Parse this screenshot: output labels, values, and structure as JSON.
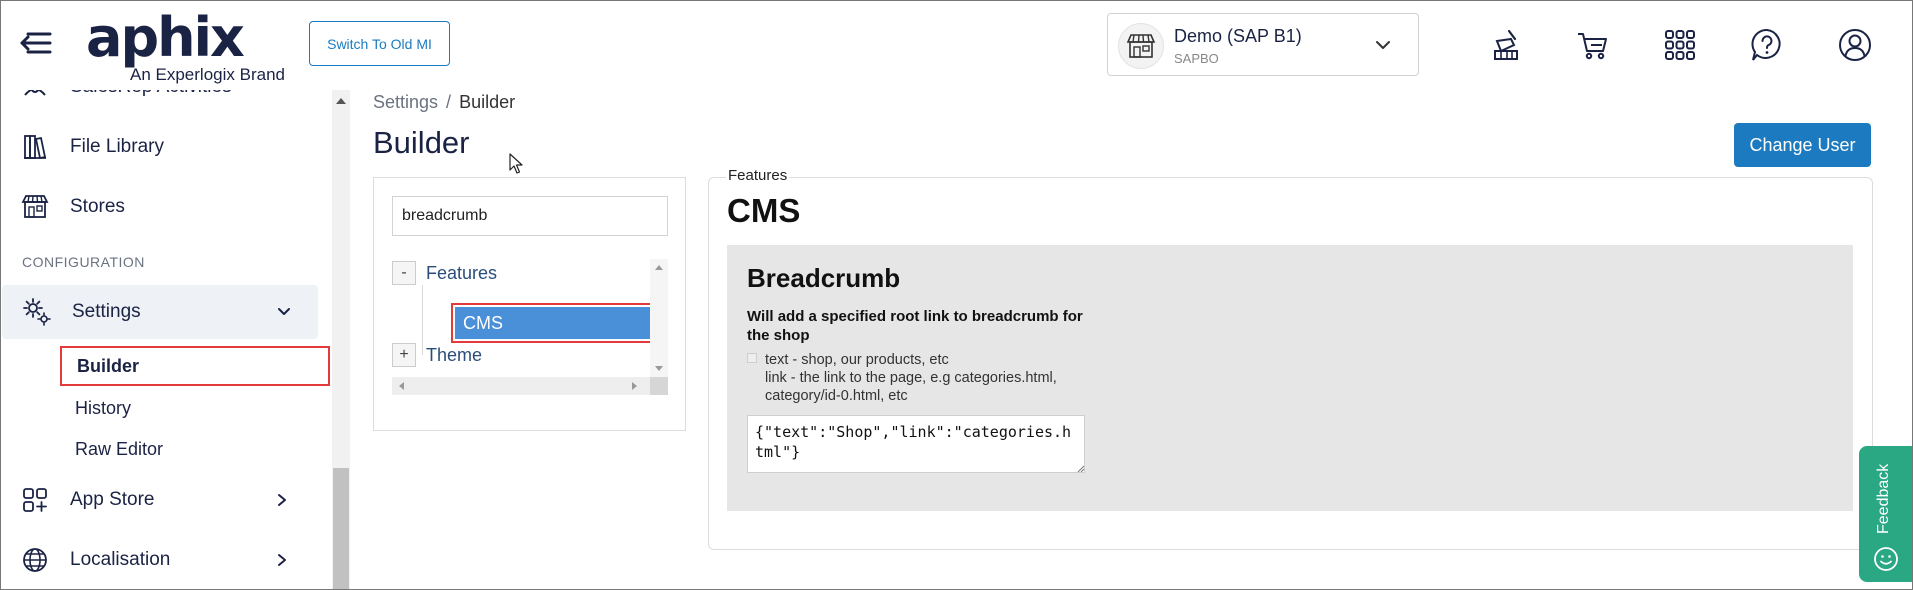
{
  "header": {
    "logo_main": "aphix",
    "logo_sub": "An Experlogix Brand",
    "old_mi_label": "Switch To Old MI",
    "company": {
      "name": "Demo (SAP B1)",
      "code": "SAPBO"
    }
  },
  "sidebar": {
    "items_top": [
      {
        "label": "SalesRep Activities"
      },
      {
        "label": "File Library"
      },
      {
        "label": "Stores"
      }
    ],
    "section_label": "CONFIGURATION",
    "settings_label": "Settings",
    "sub_items": [
      {
        "label": "Builder"
      },
      {
        "label": "History"
      },
      {
        "label": "Raw Editor"
      }
    ],
    "items_bottom": [
      {
        "label": "App Store"
      },
      {
        "label": "Localisation"
      }
    ]
  },
  "main": {
    "breadcrumb": {
      "parent": "Settings",
      "separator": "/",
      "current": "Builder"
    },
    "title": "Builder",
    "change_user_label": "Change User",
    "tree": {
      "search_value": "breadcrumb",
      "nodes": [
        {
          "label": "Features",
          "toggle": "-"
        },
        {
          "label": "CMS"
        },
        {
          "label": "Theme",
          "toggle": "+"
        }
      ]
    },
    "features": {
      "legend": "Features",
      "section_title": "CMS",
      "card": {
        "title": "Breadcrumb",
        "description": "Will add a specified root link to breadcrumb for the shop",
        "help_line_1": "text - shop, our products, etc",
        "help_line_2": "link - the link to the page, e.g categories.html, category/id-0.html, etc",
        "json_value": "{\"text\":\"Shop\",\"link\":\"categories.html\"}"
      }
    }
  },
  "feedback": {
    "label": "Feedback"
  },
  "colors": {
    "accent": "#1c7bc0",
    "navy": "#1b2345",
    "selection": "#4a90d9",
    "highlight_border": "#e33b3b",
    "feedback": "#2aa783"
  }
}
